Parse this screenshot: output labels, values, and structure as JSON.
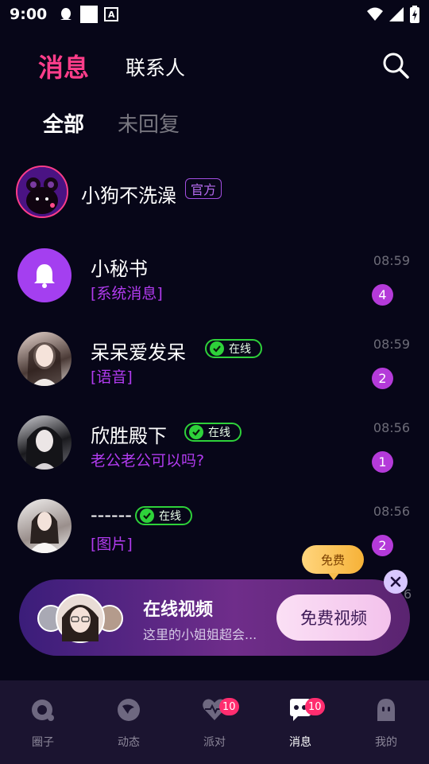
{
  "status_bar": {
    "time": "9:00",
    "a_glyph": "A"
  },
  "header": {
    "tab_messages": "消息",
    "tab_contacts": "联系人"
  },
  "subtabs": {
    "all": "全部",
    "unreplied": "未回复"
  },
  "pinned": {
    "name": "小狗不洗澡",
    "tag": "官方"
  },
  "conversations": [
    {
      "name": "小秘书",
      "preview": "[系统消息]",
      "time": "08:59",
      "unread": "4",
      "online": ""
    },
    {
      "name": "呆呆爱发呆",
      "preview": "[语音]",
      "time": "08:59",
      "unread": "2",
      "online": "在线"
    },
    {
      "name": "欣胜殿下",
      "preview": "老公老公可以吗?",
      "time": "08:56",
      "unread": "1",
      "online": "在线"
    },
    {
      "name": "------",
      "preview": "[图片]",
      "time": "08:56",
      "unread": "2",
      "online": "在线"
    }
  ],
  "hidden_row_time_tail": "6",
  "promo": {
    "bubble": "免费",
    "title": "在线视频",
    "subtitle": "这里的小姐姐超会...",
    "button": "免费视频"
  },
  "bottom_nav": [
    {
      "label": "圈子",
      "badge": ""
    },
    {
      "label": "动态",
      "badge": ""
    },
    {
      "label": "派对",
      "badge": "10"
    },
    {
      "label": "消息",
      "badge": "10"
    },
    {
      "label": "我的",
      "badge": ""
    }
  ],
  "colors": {
    "accent": "#ff3d8a",
    "purple": "#b43ad9",
    "online": "#2ed13a"
  }
}
